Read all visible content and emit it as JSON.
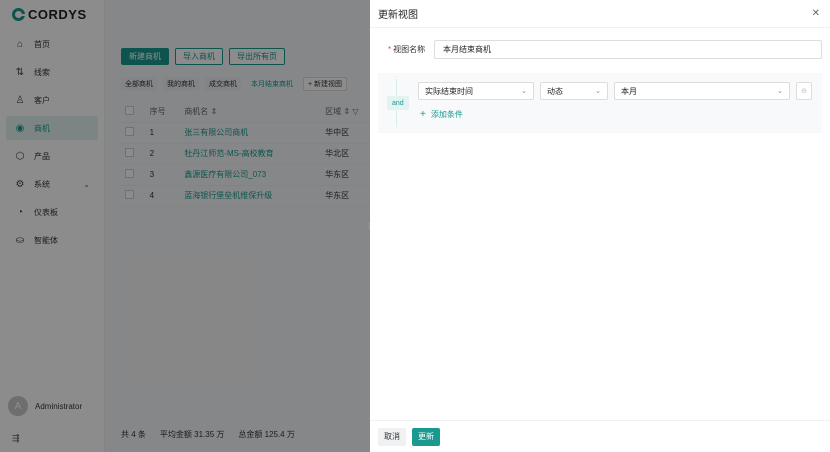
{
  "logo": {
    "text": "CORDYS"
  },
  "nav": [
    {
      "icon": "home-icon",
      "glyph": "⌂",
      "label": "首页"
    },
    {
      "icon": "leads-icon",
      "glyph": "⇅",
      "label": "线索"
    },
    {
      "icon": "customer-icon",
      "glyph": "♙",
      "label": "客户"
    },
    {
      "icon": "opportunity-icon",
      "glyph": "◉",
      "label": "商机",
      "active": true
    },
    {
      "icon": "product-icon",
      "glyph": "⬡",
      "label": "产品"
    },
    {
      "icon": "settings-icon",
      "glyph": "⚙",
      "label": "系统",
      "expandable": true
    },
    {
      "icon": "dashboard-icon",
      "glyph": "◔",
      "label": "仪表板"
    },
    {
      "icon": "agent-icon",
      "glyph": "⛀",
      "label": "智能体"
    }
  ],
  "user": {
    "avatar": "A",
    "name": "Administrator"
  },
  "toolbar": {
    "new": "新建商机",
    "import": "导入商机",
    "export": "导出所有页"
  },
  "views": [
    "全部商机",
    "我的商机",
    "成交商机",
    "本月结束商机"
  ],
  "views_new": "+ 新建视图",
  "table": {
    "headers": [
      "序号",
      "商机名",
      "区域"
    ],
    "rows": [
      {
        "no": "1",
        "name": "张三有限公司商机",
        "region": "华中区"
      },
      {
        "no": "2",
        "name": "牡丹江师范-MS-高校教育",
        "region": "华北区"
      },
      {
        "no": "3",
        "name": "鑫源医疗有限公司_073",
        "region": "华东区"
      },
      {
        "no": "4",
        "name": "蓝海银行堡垒机维保升级",
        "region": "华东区"
      }
    ]
  },
  "footer": {
    "count": "共 4 条",
    "avg": "平均金额  31.35 万",
    "total": "总金额  125.4 万"
  },
  "drawer": {
    "title": "更新视图",
    "name_label": "视图名称",
    "name_value": "本月结束商机",
    "logic": "and",
    "condition": {
      "field": "实际结束时间",
      "operator": "动态",
      "value": "本月"
    },
    "add_condition": "添加条件",
    "cancel": "取消",
    "submit": "更新"
  },
  "colors": {
    "accent": "#1a9a8f",
    "required": "#e04b4b"
  }
}
